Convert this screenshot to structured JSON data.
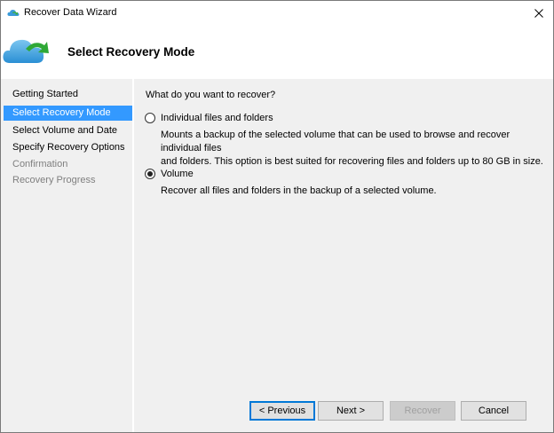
{
  "window": {
    "title": "Recover Data Wizard",
    "close_glyph": "✕"
  },
  "header": {
    "title": "Select Recovery Mode",
    "icon": "cloud-recovery-icon"
  },
  "sidebar": {
    "items": [
      {
        "label": "Getting Started",
        "state": "normal"
      },
      {
        "label": "Select Recovery Mode",
        "state": "selected"
      },
      {
        "label": "Select Volume and Date",
        "state": "normal"
      },
      {
        "label": "Specify Recovery Options",
        "state": "normal"
      },
      {
        "label": "Confirmation",
        "state": "disabled"
      },
      {
        "label": "Recovery Progress",
        "state": "disabled"
      }
    ]
  },
  "content": {
    "question": "What do you want to recover?",
    "options": [
      {
        "label": "Individual files and folders",
        "selected": false,
        "desc_line1": "Mounts a backup of the selected volume that can be used to browse and recover individual files",
        "desc_line2": "and folders. This option is best suited for recovering files and folders up to 80 GB in size."
      },
      {
        "label": "Volume",
        "selected": true,
        "desc_line1": "Recover all files and folders in the backup of a selected volume."
      }
    ]
  },
  "buttons": {
    "previous": "< Previous",
    "next": "Next >",
    "recover": "Recover",
    "cancel": "Cancel"
  },
  "colors": {
    "selection": "#3399ff",
    "panel": "#f0f0f0",
    "default_button_border": "#0078d7"
  }
}
